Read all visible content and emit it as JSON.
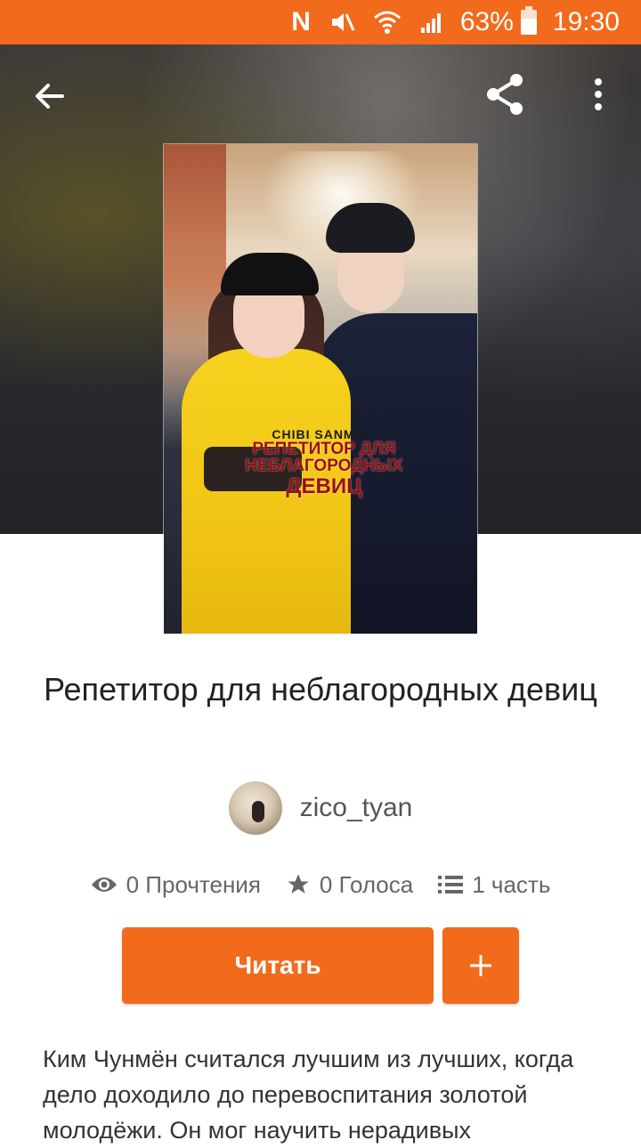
{
  "status_bar": {
    "battery": "63%",
    "time": "19:30"
  },
  "cover": {
    "author_text": "CHIBI SANMIN",
    "title_line1": "РЕПЕТИТОР ДЛЯ",
    "title_line2": "НЕБЛАГОРОДНЫХ",
    "title_line3": "ДЕВИЦ"
  },
  "story": {
    "title": "Репетитор для неблагородных девиц",
    "author": "zico_tyan",
    "stats": {
      "reads": "0 Прочтения",
      "votes": "0 Голоса",
      "parts": "1 часть"
    },
    "description": "Ким Чунмён считался лучшим из лучших, когда дело доходило до перевоспитания золотой молодёжи. Он мог научить нерадивых"
  },
  "actions": {
    "read_label": "Читать",
    "add_label": "+"
  },
  "colors": {
    "accent": "#f26a1b"
  }
}
